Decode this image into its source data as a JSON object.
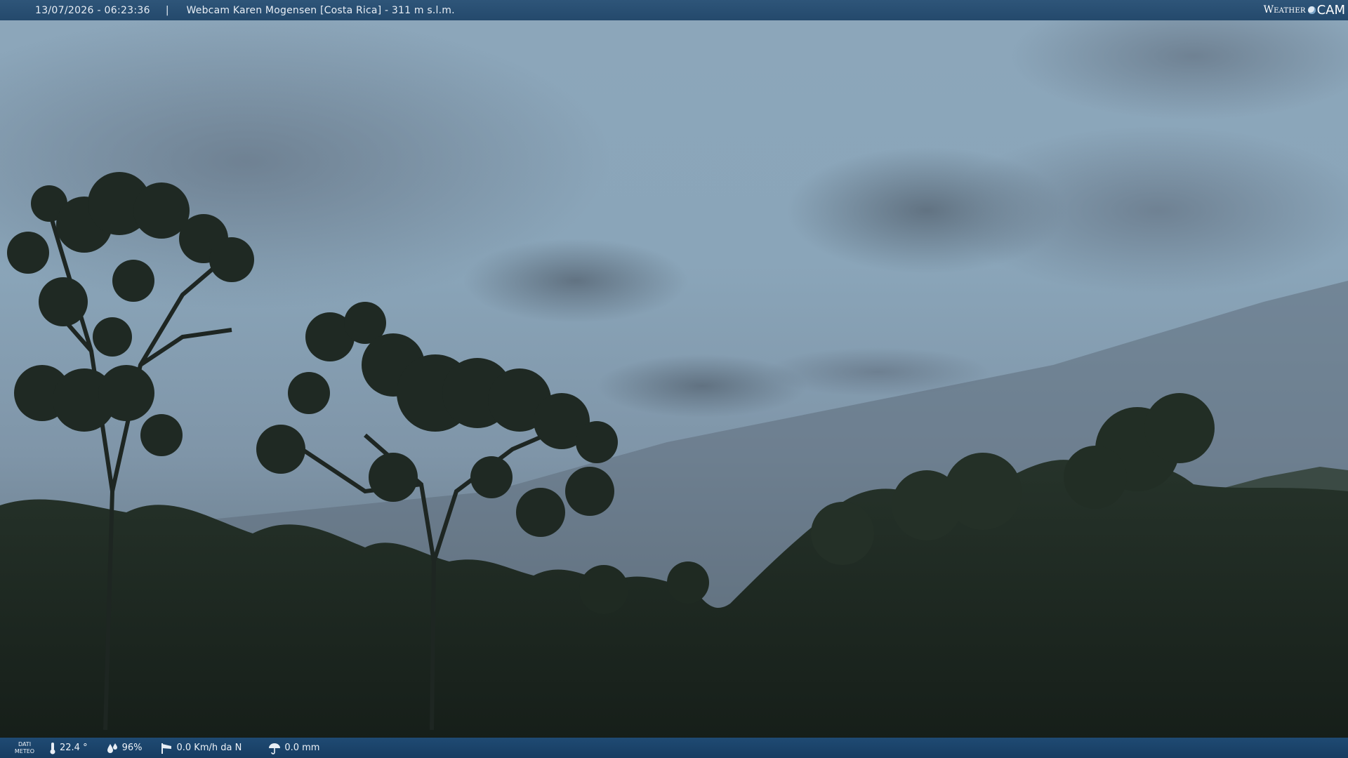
{
  "overlay": {
    "timestamp": "13/07/2026 - 06:23:36",
    "separator": "|",
    "title": "Webcam Karen Mogensen [Costa Rica]  - 311 m s.l.m.",
    "logo_part1": "Weather",
    "logo_part2": "CAM"
  },
  "weather": {
    "label_line1": "DATI",
    "label_line2": "METEO",
    "temperature": "22.4 °",
    "temperature_icon": "thermometer-icon",
    "humidity": "96%",
    "humidity_icon": "droplets-icon",
    "wind": "0.0 Km/h da N",
    "wind_icon": "windsock-icon",
    "rain": "0.0 mm",
    "rain_icon": "umbrella-icon"
  },
  "colors": {
    "bar": "#24496c",
    "sky_top": "#8da7bb",
    "foliage": "#1f2a22"
  }
}
